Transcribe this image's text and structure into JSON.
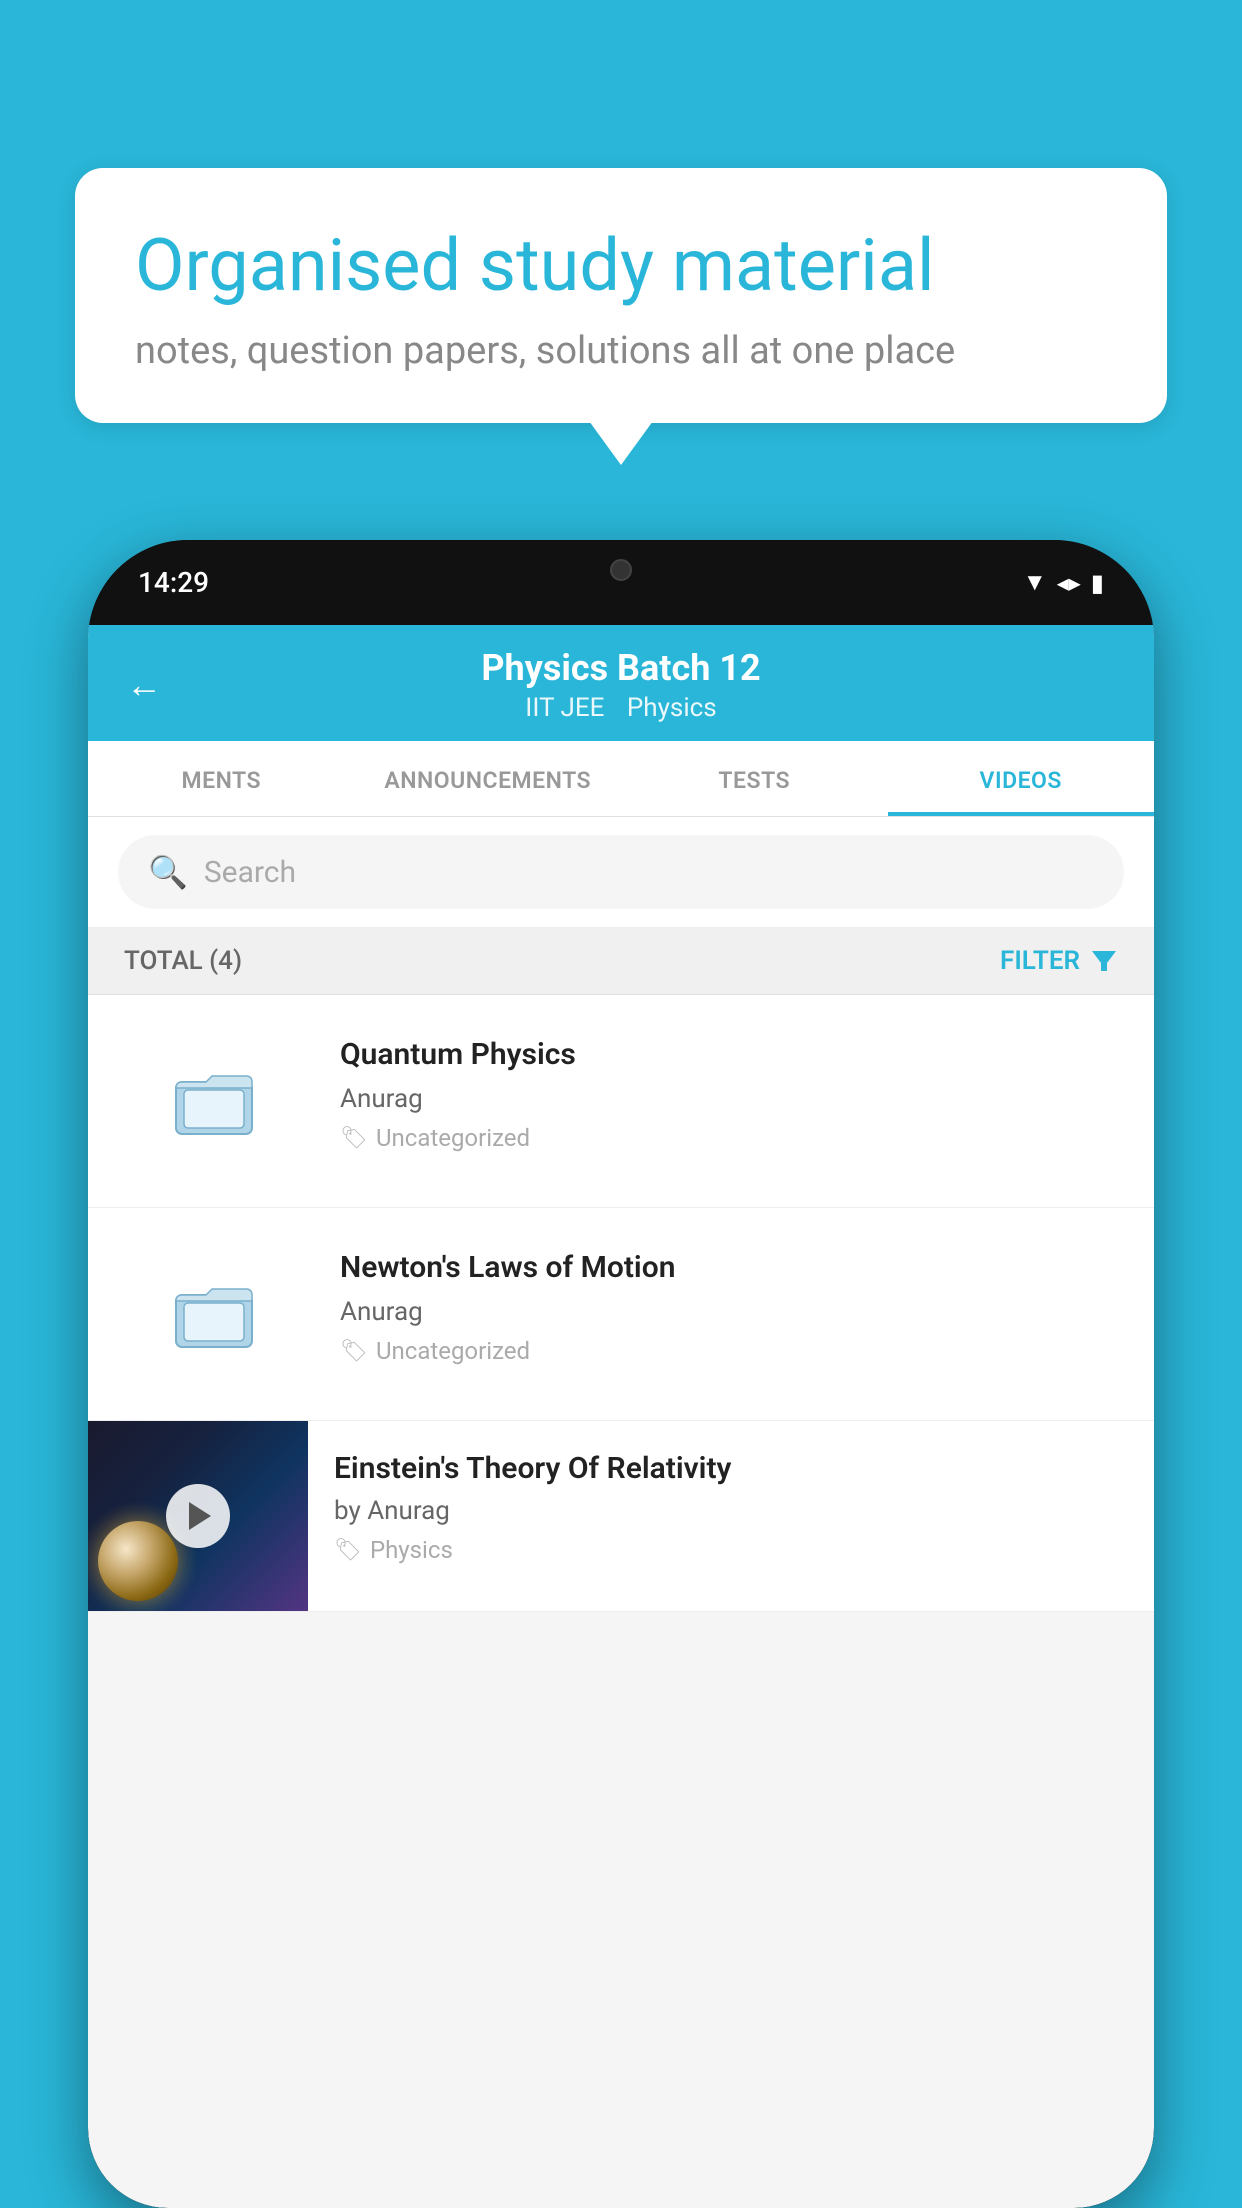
{
  "background_color": "#29b6d8",
  "speech_bubble": {
    "title": "Organised study material",
    "subtitle": "notes, question papers, solutions all at one place"
  },
  "phone": {
    "time": "14:29",
    "header": {
      "back_label": "←",
      "title": "Physics Batch 12",
      "subtitle1": "IIT JEE",
      "subtitle2": "Physics"
    },
    "tabs": [
      {
        "label": "MENTS",
        "active": false
      },
      {
        "label": "ANNOUNCEMENTS",
        "active": false
      },
      {
        "label": "TESTS",
        "active": false
      },
      {
        "label": "VIDEOS",
        "active": true
      }
    ],
    "search": {
      "placeholder": "Search"
    },
    "filter_bar": {
      "total_label": "TOTAL (4)",
      "filter_label": "FILTER"
    },
    "videos": [
      {
        "id": 1,
        "title": "Quantum Physics",
        "author": "Anurag",
        "tag": "Uncategorized",
        "has_thumbnail": false
      },
      {
        "id": 2,
        "title": "Newton's Laws of Motion",
        "author": "Anurag",
        "tag": "Uncategorized",
        "has_thumbnail": false
      },
      {
        "id": 3,
        "title": "Einstein's Theory Of Relativity",
        "author": "by Anurag",
        "tag": "Physics",
        "has_thumbnail": true
      }
    ]
  }
}
